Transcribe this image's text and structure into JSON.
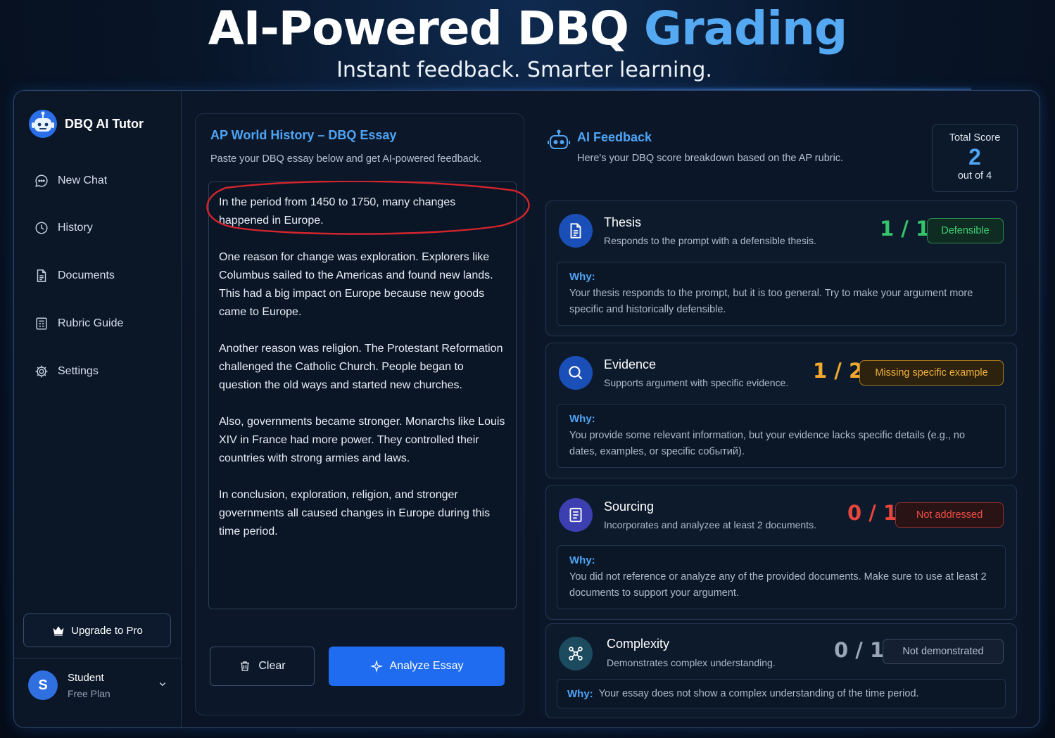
{
  "hero": {
    "title_main": "AI-Powered DBQ ",
    "title_accent": "Grading",
    "subtitle": "Instant feedback. Smarter learning."
  },
  "sidebar": {
    "brand": "DBQ AI Tutor",
    "items": [
      {
        "label": "New Chat",
        "icon": "chat-icon"
      },
      {
        "label": "History",
        "icon": "clock-icon"
      },
      {
        "label": "Documents",
        "icon": "document-icon"
      },
      {
        "label": "Rubric Guide",
        "icon": "rubric-icon"
      },
      {
        "label": "Settings",
        "icon": "gear-icon"
      }
    ],
    "upgrade_label": "Upgrade to Pro",
    "user": {
      "initial": "S",
      "name": "Student",
      "plan": "Free Plan"
    }
  },
  "essay": {
    "title": "AP World History – DBQ Essay",
    "description": "Paste your DBQ essay below and get AI-powered feedback.",
    "paragraphs": [
      "In the period from 1450 to 1750, many changes happened in Europe.",
      "One reason for change was exploration. Explorers like Columbus sailed to the Americas and found new lands. This had a big impact on Europe because new goods came to Europe.",
      "Another reason was religion. The Protestant Reformation challenged the Catholic Church. People began to question the old ways and started new churches.",
      "Also, governments became stronger. Monarchs like Louis XIV in France had more power. They controlled their countries with strong armies and laws.",
      "In conclusion, exploration, religion, and stronger governments all caused changes in Europe during this time period."
    ],
    "clear_label": "Clear",
    "analyze_label": "Analyze Essay"
  },
  "feedback": {
    "title": "AI Feedback",
    "description": "Here's your DBQ score breakdown based on the AP rubric.",
    "total": {
      "label": "Total Score",
      "value": "2",
      "out_of": "out of 4"
    },
    "why_label": "Why:",
    "cards": [
      {
        "name": "Thesis",
        "sub": "Responds to the prompt with a defensible thesis.",
        "score": "1 / 1",
        "badge": "Defensible",
        "why": "Your thesis responds to the prompt, but it is too general. Try to make your argument more specific and historically defensible.",
        "accent": "#35c46a",
        "icon": "document-icon"
      },
      {
        "name": "Evidence",
        "sub": "Supports argument with specific evidence.",
        "score": "1 / 2",
        "badge": "Missing specific example",
        "why": "You provide some relevant information, but your evidence lacks specific details (e.g., no dates, examples, or specific событий).",
        "accent": "#f0a92e",
        "icon": "search-icon"
      },
      {
        "name": "Sourcing",
        "sub": "Incorporates and analyzee at least 2 documents.",
        "score": "0 / 1",
        "badge": "Not addressed",
        "why": "You did not reference or analyze any of the provided documents. Make sure to use at least 2 documents to support your argument.",
        "accent": "#e8453c",
        "icon": "list-document-icon"
      },
      {
        "name": "Complexity",
        "sub": "Demonstrates complex understanding.",
        "score": "0 / 1",
        "badge": "Not demonstrated",
        "why": "Your essay does not show a complex understanding of the time period.",
        "accent": "#9aa6b8",
        "icon": "network-icon"
      }
    ]
  }
}
